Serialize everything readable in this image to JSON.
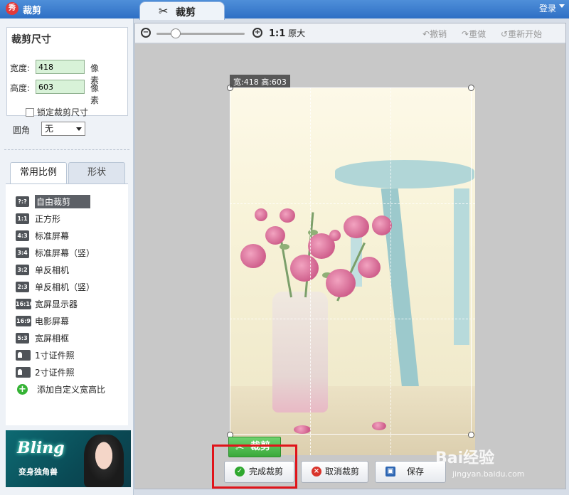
{
  "titlebar": {
    "app_icon": "秀",
    "app_title": "裁剪",
    "active_tab": "裁剪",
    "login": "登录"
  },
  "size_panel": {
    "title": "裁剪尺寸",
    "width_label": "宽度:",
    "width_value": "418",
    "width_unit": "像素",
    "height_label": "高度:",
    "height_value": "603",
    "height_unit": "像素",
    "lock_label": "锁定裁剪尺寸"
  },
  "corner": {
    "label": "圆角",
    "selected": "无"
  },
  "tabs": {
    "common": "常用比例",
    "shape": "形状"
  },
  "ratios": [
    {
      "badge": "?:?",
      "label": "自由裁剪"
    },
    {
      "badge": "1:1",
      "label": "正方形"
    },
    {
      "badge": "4:3",
      "label": "标准屏幕"
    },
    {
      "badge": "3:4",
      "label": "标准屏幕（竖）"
    },
    {
      "badge": "3:2",
      "label": "单反相机"
    },
    {
      "badge": "2:3",
      "label": "单反相机（竖）"
    },
    {
      "badge": "16:10",
      "label": "宽屏显示器"
    },
    {
      "badge": "16:9",
      "label": "电影屏幕"
    },
    {
      "badge": "5:3",
      "label": "宽屏相框"
    },
    {
      "badge": "",
      "label": "1寸证件照"
    },
    {
      "badge": "",
      "label": "2寸证件照"
    },
    {
      "badge": "+",
      "label": "添加自定义宽高比"
    }
  ],
  "banner": {
    "title": "Bling",
    "subtitle": "变身独角兽"
  },
  "toolbar": {
    "ratio_prefix": "1:1",
    "ratio_label": "原大",
    "undo": "撤销",
    "redo": "重做",
    "restart": "重新开始",
    "zoom_level": 0.22
  },
  "canvas": {
    "size_label": "宽:418 高:603",
    "crop_button": "裁剪"
  },
  "buttons": {
    "done": "完成裁剪",
    "cancel": "取消裁剪",
    "save": "保存"
  },
  "watermark": {
    "logo": "Bai经验",
    "url": "jingyan.baidu.com"
  },
  "colors": {
    "accent_blue": "#2e6fc4",
    "crop_green": "#3aa93a",
    "highlight_red": "#e0141a"
  }
}
